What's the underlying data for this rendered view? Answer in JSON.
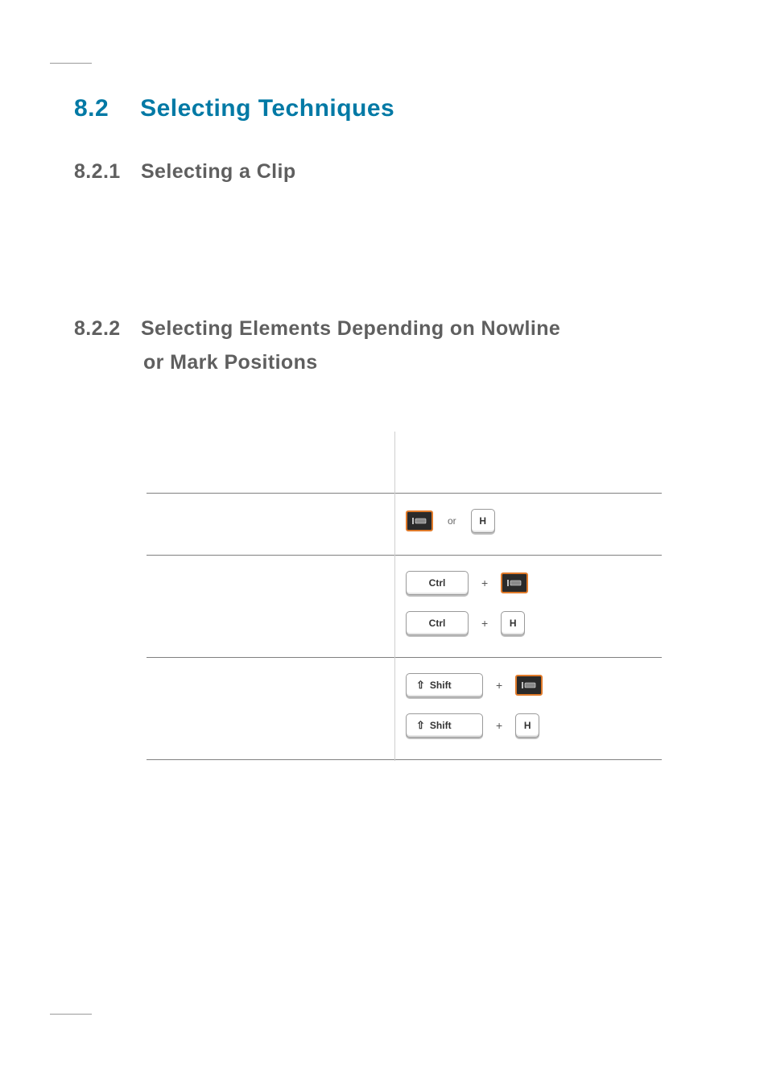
{
  "section": {
    "number": "8.2",
    "title": "Selecting Techniques"
  },
  "sub1": {
    "number": "8.2.1",
    "title": "Selecting a Clip"
  },
  "sub2": {
    "number": "8.2.2",
    "title_line1": "Selecting Elements Depending on Nowline",
    "title_line2": "or Mark Positions"
  },
  "table": {
    "header_action": "",
    "header_shortcut": "",
    "rows": [
      {
        "action": "",
        "shortcuts": [
          {
            "segments": [
              {
                "type": "tool",
                "name": "select-under-nowline-icon"
              },
              {
                "type": "text",
                "v": "or"
              },
              {
                "type": "key",
                "v": "H"
              }
            ]
          }
        ]
      },
      {
        "action": "",
        "shortcuts": [
          {
            "segments": [
              {
                "type": "key",
                "v": "Ctrl",
                "cls": "wide"
              },
              {
                "type": "text",
                "v": "+"
              },
              {
                "type": "tool",
                "name": "select-under-nowline-icon"
              }
            ]
          },
          {
            "segments": [
              {
                "type": "key",
                "v": "Ctrl",
                "cls": "wide"
              },
              {
                "type": "text",
                "v": "+"
              },
              {
                "type": "key",
                "v": "H"
              }
            ]
          }
        ]
      },
      {
        "action": "",
        "shortcuts": [
          {
            "segments": [
              {
                "type": "shift",
                "v": "Shift",
                "cls": "xwide"
              },
              {
                "type": "text",
                "v": "+"
              },
              {
                "type": "tool",
                "name": "select-under-nowline-icon"
              }
            ]
          },
          {
            "segments": [
              {
                "type": "shift",
                "v": "Shift",
                "cls": "xwide"
              },
              {
                "type": "text",
                "v": "+"
              },
              {
                "type": "key",
                "v": "H"
              }
            ]
          }
        ]
      }
    ]
  },
  "glyphs": {
    "or": "or",
    "plus": "+",
    "shift_arrow": "⇧"
  }
}
